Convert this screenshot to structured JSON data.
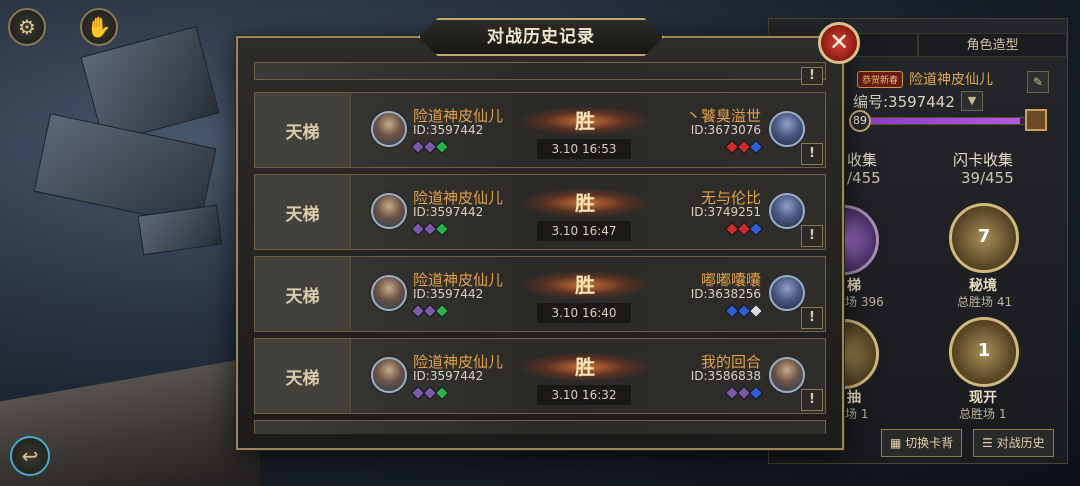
{
  "modal": {
    "title": "对战历史记录",
    "close_icon": "close-x-icon"
  },
  "matches": [
    {
      "mode": "天梯",
      "player": {
        "name": "险道神皮仙儿",
        "id": "ID:3597442",
        "gems": [
          "#7b5aa8",
          "#7b5aa8",
          "#2fb04a"
        ]
      },
      "result": "胜",
      "time": "3.10  16:53",
      "opponent": {
        "name": "丶饕臭溢世",
        "id": "ID:3673076",
        "gems": [
          "#d22a2a",
          "#d22a2a",
          "#2f5fd8"
        ],
        "avatar": "demon"
      }
    },
    {
      "mode": "天梯",
      "player": {
        "name": "险道神皮仙儿",
        "id": "ID:3597442",
        "gems": [
          "#7b5aa8",
          "#7b5aa8",
          "#2fb04a"
        ]
      },
      "result": "胜",
      "time": "3.10  16:47",
      "opponent": {
        "name": "无与伦比",
        "id": "ID:3749251",
        "gems": [
          "#d22a2a",
          "#d22a2a",
          "#2f5fd8"
        ],
        "avatar": "demon"
      }
    },
    {
      "mode": "天梯",
      "player": {
        "name": "险道神皮仙儿",
        "id": "ID:3597442",
        "gems": [
          "#7b5aa8",
          "#7b5aa8",
          "#2fb04a"
        ]
      },
      "result": "胜",
      "time": "3.10  16:40",
      "opponent": {
        "name": "嘟嘟囔囔",
        "id": "ID:3638256",
        "gems": [
          "#2f5fd8",
          "#2f5fd8",
          "#d8dde4"
        ],
        "avatar": "demon"
      }
    },
    {
      "mode": "天梯",
      "player": {
        "name": "险道神皮仙儿",
        "id": "ID:3597442",
        "gems": [
          "#7b5aa8",
          "#7b5aa8",
          "#2fb04a"
        ]
      },
      "result": "胜",
      "time": "3.10  16:32",
      "opponent": {
        "name": "我的回合",
        "id": "ID:3586838",
        "gems": [
          "#7b5aa8",
          "#7b5aa8",
          "#2f5fd8"
        ],
        "avatar": "human"
      }
    }
  ],
  "profile_panel": {
    "tabs": [
      "息",
      "角色造型"
    ],
    "badge": "恭贺新春",
    "name": "险道神皮仙儿",
    "number": "编号:3597442",
    "level": "89",
    "level_progress": 0.92,
    "collect_label": "收集",
    "collect_value": "/455",
    "flash_label": "闪卡收集",
    "flash_value": "39/455",
    "modes": [
      {
        "name": "梯",
        "wins": "场 396"
      },
      {
        "name": "秘境",
        "wins": "总胜场 41",
        "num": "7"
      },
      {
        "name": "抽",
        "wins": "场 1"
      },
      {
        "name": "现开",
        "wins": "总胜场 1",
        "num": "1"
      }
    ],
    "buttons": {
      "switch_back": "切换卡背",
      "battle_history": "对战历史"
    }
  },
  "corner": {
    "settings_icon": "gear-icon",
    "handshake_icon": "handshake-icon",
    "back_icon": "back-arrow-icon"
  },
  "colors": {
    "accent_gold": "#c2a867",
    "name_orange": "#e2a048",
    "close_red": "#c0392b"
  }
}
